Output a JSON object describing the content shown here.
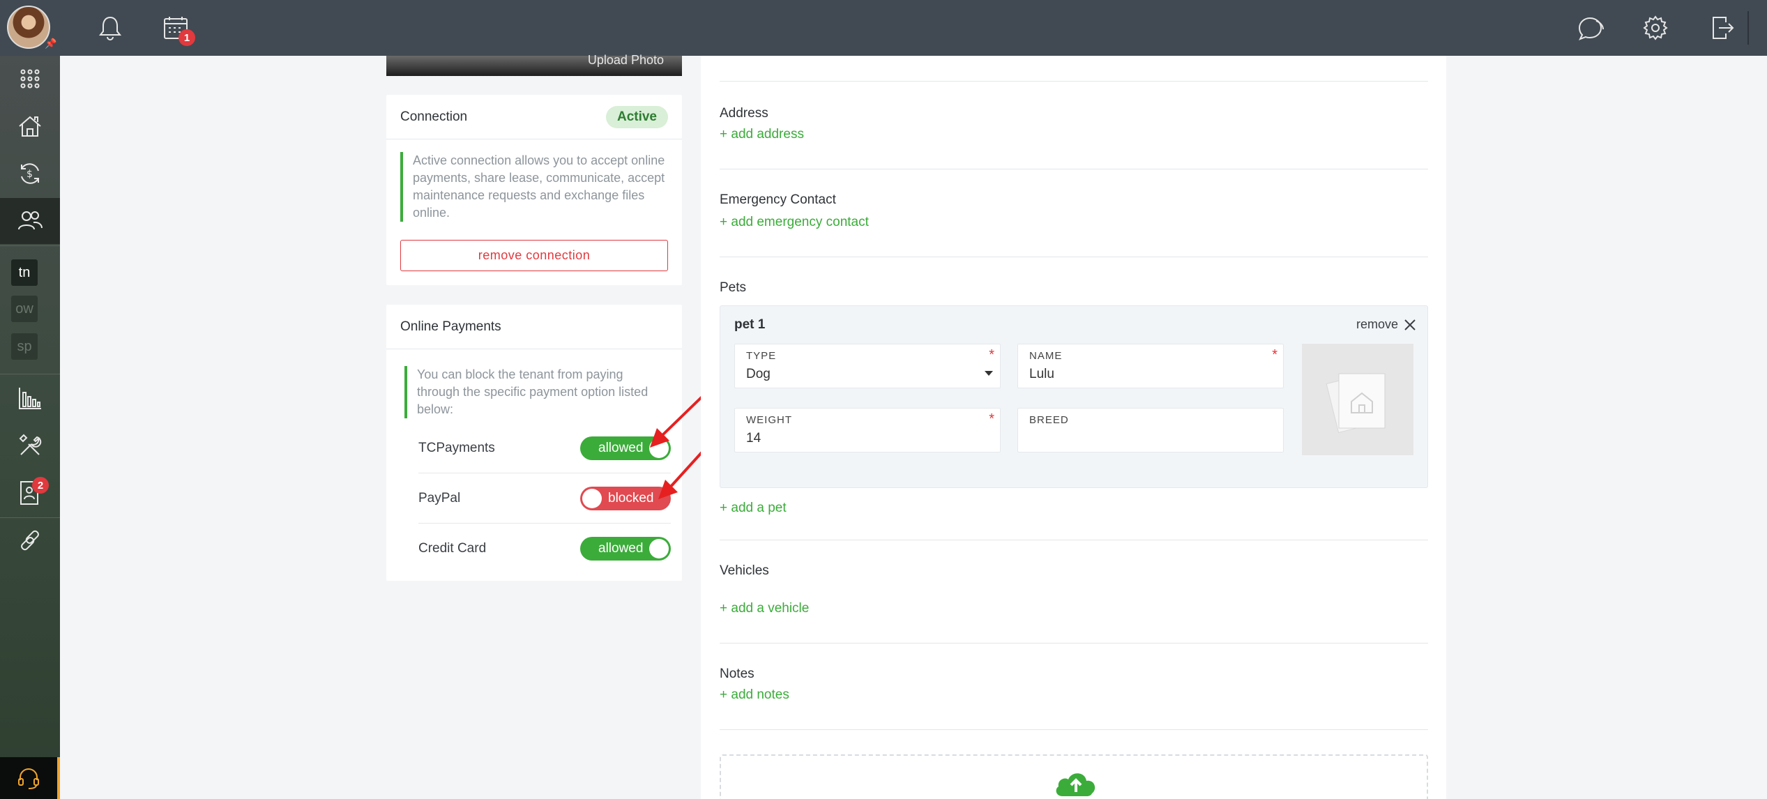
{
  "topbar": {
    "calendar_badge": "1",
    "icons": [
      "bell-icon",
      "calendar-icon",
      "chat-icon",
      "gear-icon",
      "logout-icon"
    ]
  },
  "sidebar": {
    "items": [
      {
        "name": "apps-grid-icon"
      },
      {
        "name": "properties-icon"
      },
      {
        "name": "payments-icon"
      },
      {
        "name": "people-icon",
        "active": true
      },
      {
        "abbr": "tn"
      },
      {
        "abbr": "ow"
      },
      {
        "abbr": "sp"
      },
      {
        "name": "reports-icon"
      },
      {
        "name": "maintenance-icon"
      },
      {
        "name": "applicants-icon",
        "badge": "2"
      },
      {
        "name": "link-icon"
      }
    ],
    "help_icon": "headset-icon"
  },
  "photo": {
    "upload_label": "Upload Photo"
  },
  "connection": {
    "title": "Connection",
    "status": "Active",
    "note": "Active connection allows you to accept online payments, share lease, communicate, accept maintenance requests and exchange files online.",
    "remove_label": "remove connection"
  },
  "online_payments": {
    "title": "Online Payments",
    "note": "You can block the tenant from paying through the specific payment option listed below:",
    "options": [
      {
        "label": "TCPayments",
        "state": "allowed"
      },
      {
        "label": "PayPal",
        "state": "blocked"
      },
      {
        "label": "Credit Card",
        "state": "allowed"
      }
    ]
  },
  "main": {
    "address": {
      "title": "Address",
      "link": "+ add address"
    },
    "emergency": {
      "title": "Emergency Contact",
      "link": "+ add emergency contact"
    },
    "pets": {
      "title": "Pets",
      "pet": {
        "title": "pet 1",
        "remove": "remove",
        "type_label": "TYPE",
        "type_value": "Dog",
        "name_label": "NAME",
        "name_value": "Lulu",
        "weight_label": "WEIGHT",
        "weight_value": "14",
        "breed_label": "BREED",
        "breed_value": ""
      },
      "add": "+ add a pet"
    },
    "vehicles": {
      "title": "Vehicles",
      "link": "+ add a vehicle"
    },
    "notes": {
      "title": "Notes",
      "link": "+ add notes"
    }
  },
  "colors": {
    "accent_green": "#3bac3a",
    "danger_red": "#e0393e",
    "topbar": "#414a52"
  }
}
